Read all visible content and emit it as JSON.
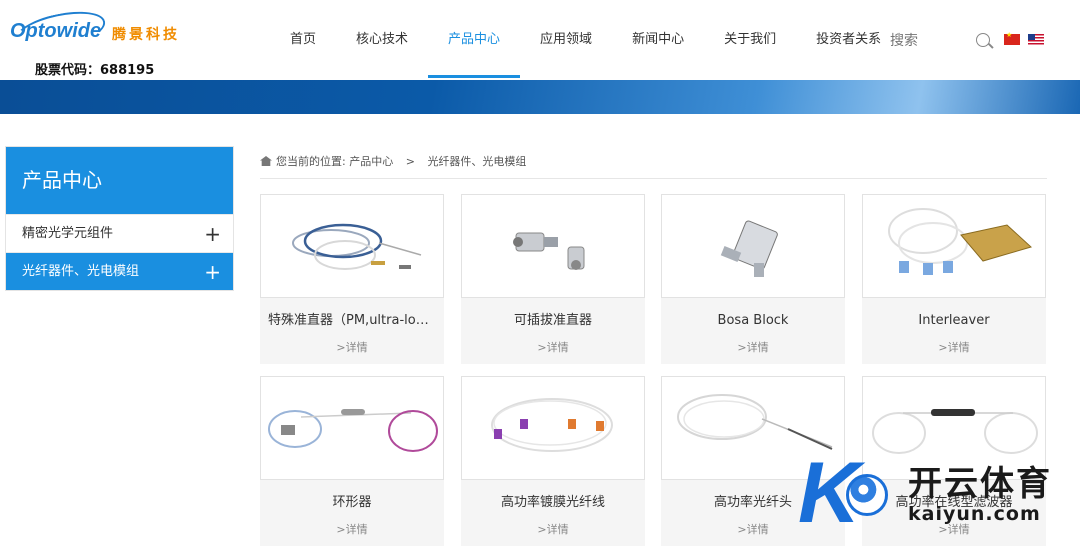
{
  "logo": {
    "brand": "Optowide",
    "cn": "腾景科技",
    "stock": "股票代码：688195"
  },
  "nav": [
    "首页",
    "核心技术",
    "产品中心",
    "应用领域",
    "新闻中心",
    "关于我们",
    "投资者关系"
  ],
  "search": {
    "placeholder": "搜索"
  },
  "sidebar": {
    "title": "产品中心",
    "items": [
      {
        "label": "精密光学元组件",
        "icon": "plus-icon"
      },
      {
        "label": "光纤器件、光电模组",
        "icon": "plus-icon"
      }
    ]
  },
  "breadcrumb": {
    "prefix": "您当前的位置:",
    "level1": "产品中心",
    "sep": ">",
    "level2": "光纤器件、光电模组"
  },
  "products": [
    {
      "name": "特殊准直器（PM,ultra-long WD）",
      "more": ">详情"
    },
    {
      "name": "可插拔准直器",
      "more": ">详情"
    },
    {
      "name": "Bosa Block",
      "more": ">详情"
    },
    {
      "name": "Interleaver",
      "more": ">详情"
    },
    {
      "name": "环形器",
      "more": ">详情"
    },
    {
      "name": "高功率镀膜光纤线",
      "more": ">详情"
    },
    {
      "name": "高功率光纤头",
      "more": ">详情"
    },
    {
      "name": "高功率在线型滤波器",
      "more": ">详情"
    }
  ],
  "watermark": {
    "cn": "开云体育",
    "en": "kaiyun.com"
  },
  "colors": {
    "accent": "#1a8fe0",
    "banner": "#0b5aa8",
    "logo_orange": "#f08c00"
  }
}
